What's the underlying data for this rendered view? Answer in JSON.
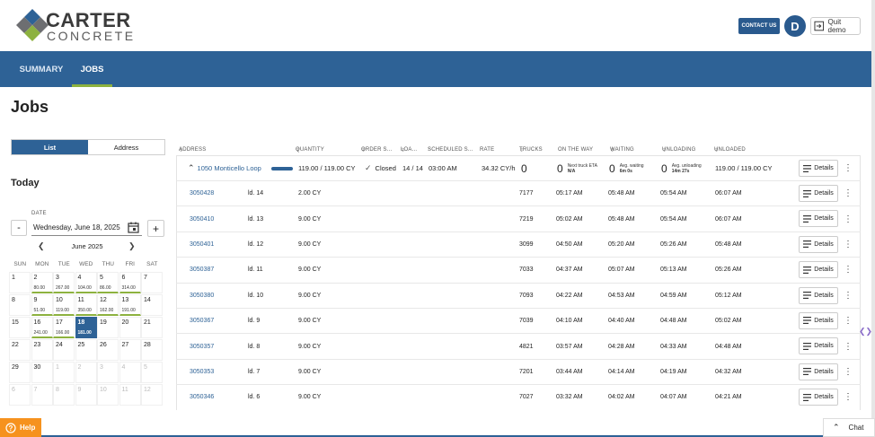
{
  "brand": {
    "line1": "CARTER",
    "line2": "CONCRETE"
  },
  "header": {
    "contact_label": "CONTACT US",
    "avatar_initial": "D",
    "quit_label": "Quit demo"
  },
  "nav": {
    "tabs": [
      {
        "label": "SUMMARY"
      },
      {
        "label": "JOBS"
      }
    ]
  },
  "page_title": "Jobs",
  "view_toggle": {
    "list": "List",
    "address": "Address"
  },
  "today_label": "Today",
  "date": {
    "label": "DATE",
    "value": "Wednesday, June 18, 2025",
    "minus": "-",
    "plus": "+"
  },
  "calendar": {
    "month": "June 2025",
    "weekdays": [
      "SUN",
      "MON",
      "TUE",
      "WED",
      "THU",
      "FRI",
      "SAT"
    ],
    "weeks": [
      [
        {
          "d": "1",
          "v": ""
        },
        {
          "d": "2",
          "v": "80.00"
        },
        {
          "d": "3",
          "v": "267.00"
        },
        {
          "d": "4",
          "v": "104.00"
        },
        {
          "d": "5",
          "v": "86.00"
        },
        {
          "d": "6",
          "v": "314.00"
        },
        {
          "d": "7",
          "v": ""
        }
      ],
      [
        {
          "d": "8",
          "v": ""
        },
        {
          "d": "9",
          "v": "51.00"
        },
        {
          "d": "10",
          "v": "119.00"
        },
        {
          "d": "11",
          "v": "350.00"
        },
        {
          "d": "12",
          "v": "162.00"
        },
        {
          "d": "13",
          "v": "191.00"
        },
        {
          "d": "14",
          "v": ""
        }
      ],
      [
        {
          "d": "15",
          "v": ""
        },
        {
          "d": "16",
          "v": "241.00"
        },
        {
          "d": "17",
          "v": "166.00"
        },
        {
          "d": "18",
          "v": "181.00"
        },
        {
          "d": "19",
          "v": ""
        },
        {
          "d": "20",
          "v": ""
        },
        {
          "d": "21",
          "v": ""
        }
      ],
      [
        {
          "d": "22",
          "v": ""
        },
        {
          "d": "23",
          "v": ""
        },
        {
          "d": "24",
          "v": ""
        },
        {
          "d": "25",
          "v": ""
        },
        {
          "d": "26",
          "v": ""
        },
        {
          "d": "27",
          "v": ""
        },
        {
          "d": "28",
          "v": ""
        }
      ],
      [
        {
          "d": "29",
          "v": ""
        },
        {
          "d": "30",
          "v": ""
        },
        {
          "d": "1",
          "v": ""
        },
        {
          "d": "2",
          "v": ""
        },
        {
          "d": "3",
          "v": ""
        },
        {
          "d": "4",
          "v": ""
        },
        {
          "d": "5",
          "v": ""
        }
      ],
      [
        {
          "d": "6",
          "v": ""
        },
        {
          "d": "7",
          "v": ""
        },
        {
          "d": "8",
          "v": ""
        },
        {
          "d": "9",
          "v": ""
        },
        {
          "d": "10",
          "v": ""
        },
        {
          "d": "11",
          "v": ""
        },
        {
          "d": "12",
          "v": ""
        }
      ]
    ],
    "selected_day": "18"
  },
  "table": {
    "headers": [
      "ADDRESS",
      "QUANTITY",
      "ORDER S...",
      "LOA...",
      "SCHEDULED S...",
      "RATE",
      "TRUCKS",
      "ON THE WAY",
      "WAITING",
      "UNLOADING",
      "UNLOADED"
    ],
    "group": {
      "address": "1050 Monticello Loop",
      "quantity": "119.00 / 119.00 CY",
      "progress": 1.0,
      "status": "Closed",
      "loads": "14 / 14",
      "scheduled": "03:00 AM",
      "rate": "34.32 CY/h",
      "trucks": "0",
      "on_the_way": "0",
      "on_the_way_note1": "Next truck ETA",
      "on_the_way_note2": "N/A",
      "waiting": "0",
      "waiting_note1": "Avg. waiting",
      "waiting_note2": "6m 0s",
      "unloading": "0",
      "unloading_note1": "Avg. unloading",
      "unloading_note2": "14m 27s",
      "unloaded": "119.00 / 119.00 CY",
      "details": "Details"
    },
    "rows": [
      {
        "ticket": "3050428",
        "load": "ld. 14",
        "qty": "2.00 CY",
        "truck": "7177",
        "t1": "05:17 AM",
        "t2": "05:48 AM",
        "t3": "05:54 AM",
        "t4": "06:07 AM",
        "details": "Details"
      },
      {
        "ticket": "3050410",
        "load": "ld. 13",
        "qty": "9.00 CY",
        "truck": "7219",
        "t1": "05:02 AM",
        "t2": "05:48 AM",
        "t3": "05:54 AM",
        "t4": "06:07 AM",
        "details": "Details"
      },
      {
        "ticket": "3050401",
        "load": "ld. 12",
        "qty": "9.00 CY",
        "truck": "3099",
        "t1": "04:50 AM",
        "t2": "05:20 AM",
        "t3": "05:26 AM",
        "t4": "05:48 AM",
        "details": "Details"
      },
      {
        "ticket": "3050387",
        "load": "ld. 11",
        "qty": "9.00 CY",
        "truck": "7033",
        "t1": "04:37 AM",
        "t2": "05:07 AM",
        "t3": "05:13 AM",
        "t4": "05:26 AM",
        "details": "Details"
      },
      {
        "ticket": "3050380",
        "load": "ld. 10",
        "qty": "9.00 CY",
        "truck": "7093",
        "t1": "04:22 AM",
        "t2": "04:53 AM",
        "t3": "04:59 AM",
        "t4": "05:12 AM",
        "details": "Details"
      },
      {
        "ticket": "3050367",
        "load": "ld. 9",
        "qty": "9.00 CY",
        "truck": "7039",
        "t1": "04:10 AM",
        "t2": "04:40 AM",
        "t3": "04:48 AM",
        "t4": "05:02 AM",
        "details": "Details"
      },
      {
        "ticket": "3050357",
        "load": "ld. 8",
        "qty": "9.00 CY",
        "truck": "4821",
        "t1": "03:57 AM",
        "t2": "04:28 AM",
        "t3": "04:33 AM",
        "t4": "04:48 AM",
        "details": "Details"
      },
      {
        "ticket": "3050353",
        "load": "ld. 7",
        "qty": "9.00 CY",
        "truck": "7201",
        "t1": "03:44 AM",
        "t2": "04:14 AM",
        "t3": "04:19 AM",
        "t4": "04:32 AM",
        "details": "Details"
      },
      {
        "ticket": "3050346",
        "load": "ld. 6",
        "qty": "9.00 CY",
        "truck": "7027",
        "t1": "03:32 AM",
        "t2": "04:02 AM",
        "t3": "04:07 AM",
        "t4": "04:21 AM",
        "details": "Details"
      }
    ]
  },
  "footer": {
    "help": "Help",
    "chat": "Chat"
  },
  "colors": {
    "primary": "#2e6296",
    "accent_green": "#8db23f",
    "help_orange": "#f6921e"
  }
}
